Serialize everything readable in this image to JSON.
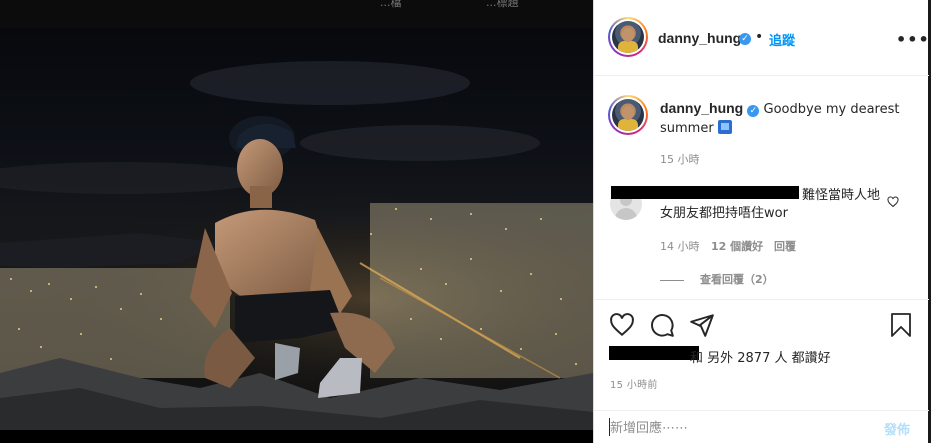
{
  "top_strip": {
    "fragment_left": "...檔",
    "fragment_right": "...標題"
  },
  "post": {
    "author": "danny_hung",
    "verified": true,
    "follow_label": "追蹤",
    "separator": "•",
    "more_label": "•••",
    "caption": {
      "username": "danny_hung",
      "text": "Goodbye my dearest summer",
      "emoji": "city-night-emoji",
      "time": "15 小時"
    }
  },
  "comments": [
    {
      "username_redacted": true,
      "text": "難怪當時人地女朋友都把持唔住wor",
      "time": "14 小時",
      "likes": "12 個讚好",
      "reply_label": "回覆",
      "view_replies_label": "查看回覆（2）"
    }
  ],
  "actions": {
    "like_icon": "heart-icon",
    "comment_icon": "comment-icon",
    "share_icon": "send-icon",
    "save_icon": "bookmark-icon"
  },
  "likes": {
    "prefix_redacted": true,
    "text": "和 另外 2877 人 都讚好"
  },
  "posted_time": "15 小時前",
  "comment_box": {
    "placeholder": "新增回應⋯⋯",
    "post_label": "發佈"
  },
  "colors": {
    "accent": "#0095f6",
    "verified": "#3897f0",
    "muted": "#8e8e8e",
    "post_disabled": "#b2dffc"
  }
}
